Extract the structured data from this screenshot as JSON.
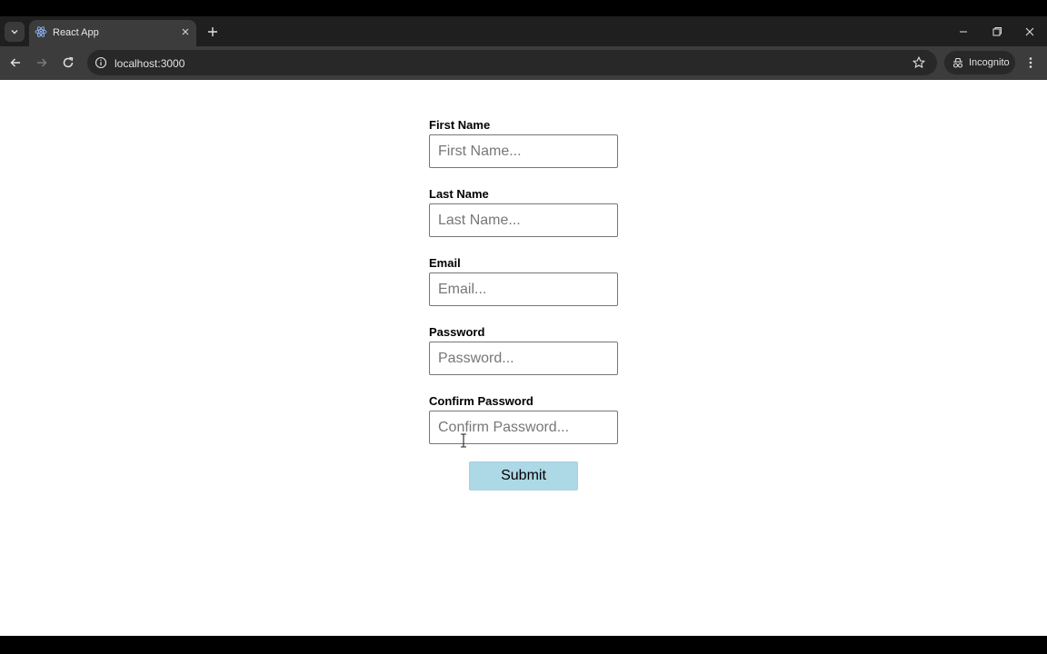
{
  "browser": {
    "tab": {
      "title": "React App"
    },
    "address_bar": {
      "url": "localhost:3000"
    },
    "profile": {
      "label": "Incognito"
    },
    "colors": {
      "frame": "#1f1f1f",
      "toolbar": "#3c3c3c",
      "omnibox": "#282828"
    },
    "icons": [
      "chevron-down-icon",
      "react-logo-icon",
      "close-icon",
      "plus-icon",
      "minimize-icon",
      "restore-icon",
      "back-icon",
      "forward-icon",
      "reload-icon",
      "info-icon",
      "star-icon",
      "incognito-icon",
      "kebab-menu-icon"
    ]
  },
  "form": {
    "fields": [
      {
        "label": "First Name",
        "placeholder": "First Name..."
      },
      {
        "label": "Last Name",
        "placeholder": "Last Name..."
      },
      {
        "label": "Email",
        "placeholder": "Email..."
      },
      {
        "label": "Password",
        "placeholder": "Password..."
      },
      {
        "label": "Confirm Password",
        "placeholder": "Confirm Password..."
      }
    ],
    "submit_label": "Submit",
    "colors": {
      "submit_bg": "#add8e6",
      "input_border": "#767676"
    }
  }
}
